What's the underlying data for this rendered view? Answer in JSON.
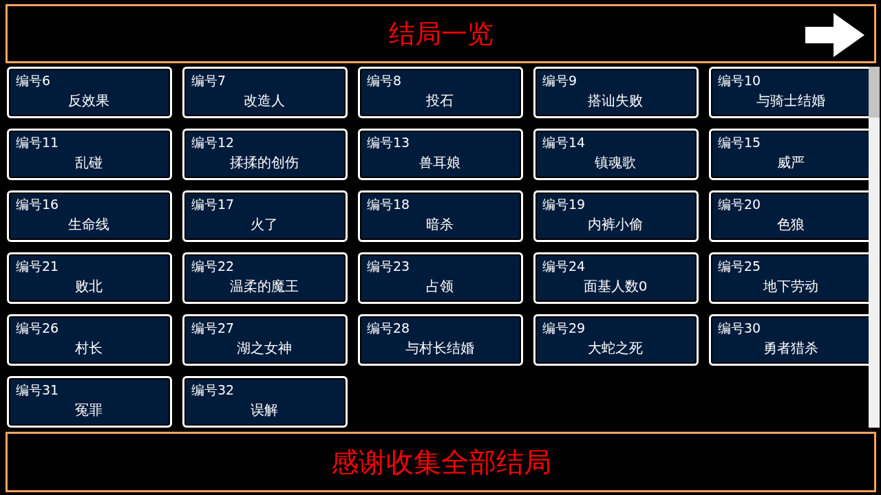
{
  "header": {
    "title": "结局一览"
  },
  "endings": [
    {
      "number": "编号6",
      "title": "反效果"
    },
    {
      "number": "编号7",
      "title": "改造人"
    },
    {
      "number": "编号8",
      "title": "投石"
    },
    {
      "number": "编号9",
      "title": "搭讪失败"
    },
    {
      "number": "编号10",
      "title": "与骑士结婚"
    },
    {
      "number": "编号11",
      "title": "乱碰"
    },
    {
      "number": "编号12",
      "title": "揉揉的创伤"
    },
    {
      "number": "编号13",
      "title": "兽耳娘"
    },
    {
      "number": "编号14",
      "title": "镇魂歌"
    },
    {
      "number": "编号15",
      "title": "威严"
    },
    {
      "number": "编号16",
      "title": "生命线"
    },
    {
      "number": "编号17",
      "title": "火了"
    },
    {
      "number": "编号18",
      "title": "暗杀"
    },
    {
      "number": "编号19",
      "title": "内裤小偷"
    },
    {
      "number": "编号20",
      "title": "色狼"
    },
    {
      "number": "编号21",
      "title": "败北"
    },
    {
      "number": "编号22",
      "title": "温柔的魔王"
    },
    {
      "number": "编号23",
      "title": "占领"
    },
    {
      "number": "编号24",
      "title": "面基人数0"
    },
    {
      "number": "编号25",
      "title": "地下劳动"
    },
    {
      "number": "编号26",
      "title": "村长"
    },
    {
      "number": "编号27",
      "title": "湖之女神"
    },
    {
      "number": "编号28",
      "title": "与村长结婚"
    },
    {
      "number": "编号29",
      "title": "大蛇之死"
    },
    {
      "number": "编号30",
      "title": "勇者猎杀"
    },
    {
      "number": "编号31",
      "title": "冤罪"
    },
    {
      "number": "编号32",
      "title": "误解"
    }
  ],
  "footer": {
    "message": "感谢收集全部结局"
  }
}
